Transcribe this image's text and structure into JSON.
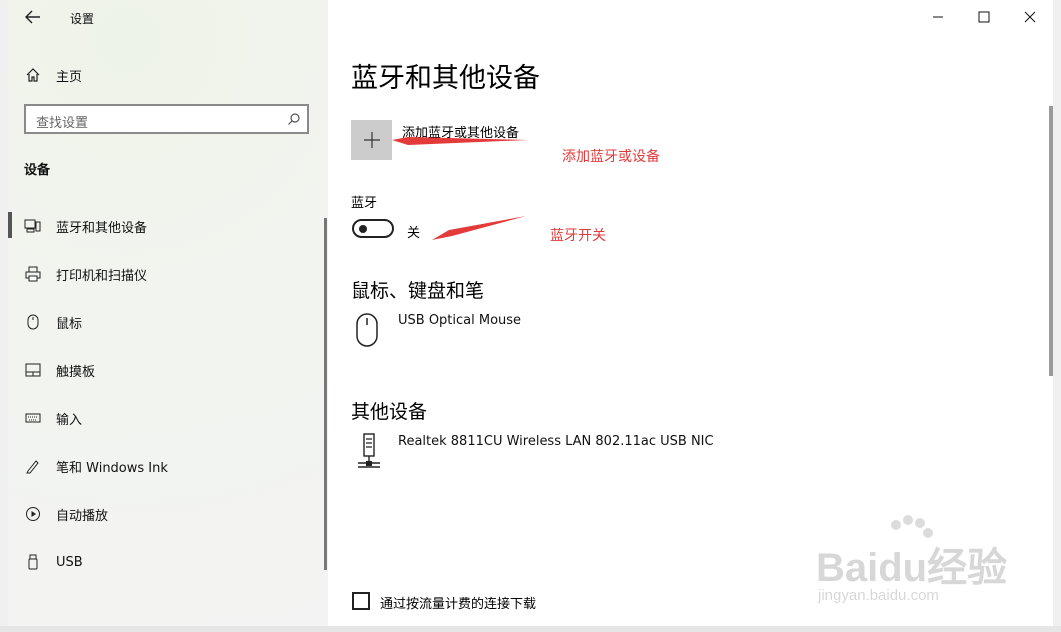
{
  "window": {
    "title": "设置"
  },
  "sidebar": {
    "home_label": "主页",
    "search_placeholder": "查找设置",
    "section_title": "设备",
    "items": [
      {
        "label": "蓝牙和其他设备",
        "icon": "bluetooth-devices-icon",
        "selected": true
      },
      {
        "label": "打印机和扫描仪",
        "icon": "printer-icon"
      },
      {
        "label": "鼠标",
        "icon": "mouse-icon"
      },
      {
        "label": "触摸板",
        "icon": "touchpad-icon"
      },
      {
        "label": "输入",
        "icon": "keyboard-icon"
      },
      {
        "label": "笔和 Windows Ink",
        "icon": "pen-icon"
      },
      {
        "label": "自动播放",
        "icon": "autoplay-icon"
      },
      {
        "label": "USB",
        "icon": "usb-icon"
      }
    ]
  },
  "main": {
    "title": "蓝牙和其他设备",
    "add_device_label": "添加蓝牙或其他设备",
    "bluetooth": {
      "label": "蓝牙",
      "state": "关"
    },
    "mouse_section": {
      "heading": "鼠标、键盘和笔",
      "devices": [
        "USB Optical Mouse"
      ]
    },
    "other_section": {
      "heading": "其他设备",
      "devices": [
        "Realtek 8811CU Wireless LAN 802.11ac USB NIC"
      ]
    },
    "metered_checkbox_label": "通过按流量计费的连接下载"
  },
  "annotations": {
    "add_note": "添加蓝牙或设备",
    "toggle_note": "蓝牙开关",
    "color": "#e33a3a"
  },
  "watermark": {
    "main": "Baidu经验",
    "sub": "jingyan.baidu.com"
  }
}
